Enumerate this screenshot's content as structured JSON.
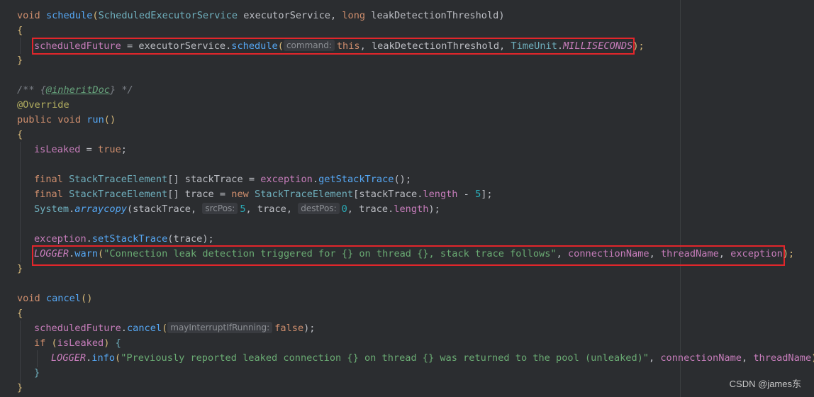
{
  "watermark": "CSDN @james东",
  "code": {
    "l1": [
      "void",
      "schedule",
      "(",
      "ScheduledExecutorService",
      " executorService, ",
      "long",
      " leakDetectionThreshold)"
    ],
    "l2": "{",
    "l3": [
      "scheduledFuture",
      " = executorService.",
      "schedule",
      "(",
      "command:",
      "this",
      ", leakDetectionThreshold, ",
      "TimeUnit",
      ".",
      "MILLISECONDS",
      ");"
    ],
    "l4": "}",
    "l6": [
      "/** {",
      "@inheritDoc",
      "} */"
    ],
    "l7": "@Override",
    "l8": [
      "public",
      " ",
      "void",
      " ",
      "run",
      "()"
    ],
    "l9": "{",
    "l10": [
      "isLeaked",
      " = ",
      "true",
      ";"
    ],
    "l12": [
      "final",
      " ",
      "StackTraceElement",
      "[] stackTrace = ",
      "exception",
      ".",
      "getStackTrace",
      "();"
    ],
    "l13": [
      "final",
      " ",
      "StackTraceElement",
      "[] trace = ",
      "new",
      " ",
      "StackTraceElement",
      "[stackTrace.",
      "length",
      " - ",
      "5",
      "];"
    ],
    "l14": [
      "System",
      ".",
      "arraycopy",
      "(stackTrace, ",
      "srcPos:",
      "5",
      ", trace, ",
      "destPos:",
      "0",
      ", trace.",
      "length",
      ");"
    ],
    "l16": [
      "exception",
      ".",
      "setStackTrace",
      "(trace);"
    ],
    "l17": [
      "LOGGER",
      ".",
      "warn",
      "(",
      "\"Connection leak detection triggered for {} on thread {}, stack trace follows\"",
      ", ",
      "connectionName",
      ", ",
      "threadName",
      ", ",
      "exception",
      ");"
    ],
    "l18": "}",
    "l20": [
      "void",
      " ",
      "cancel",
      "()"
    ],
    "l21": "{",
    "l22": [
      "scheduledFuture",
      ".",
      "cancel",
      "(",
      "mayInterruptIfRunning:",
      "false",
      ");"
    ],
    "l23": [
      "if",
      " (",
      "isLeaked",
      ") ",
      "{"
    ],
    "l24": [
      "LOGGER",
      ".",
      "info",
      "(",
      "\"Previously reported leaked connection {} on thread {} was returned to the pool (unleaked)\"",
      ", ",
      "connectionName",
      ", ",
      "threadName",
      ");"
    ],
    "l25": "}",
    "l26": "}"
  },
  "colors": {
    "background": "#2b2d30",
    "highlight_box": "#e2262b",
    "keyword": "#cf8e6d",
    "string": "#6aab73",
    "field": "#c77dbb",
    "method": "#56a8f5",
    "type": "#6fafbd"
  }
}
